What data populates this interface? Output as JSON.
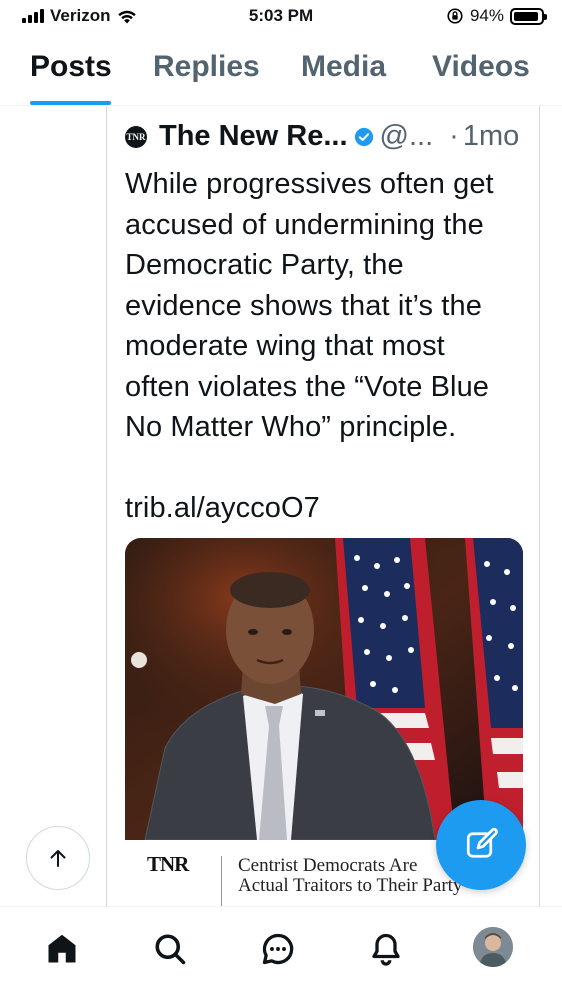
{
  "status_bar": {
    "carrier": "Verizon",
    "time": "5:03 PM",
    "battery_percent": "94%",
    "battery_level": 0.94,
    "icons": [
      "signal-icon",
      "wifi-icon",
      "orientation-lock-icon",
      "battery-icon"
    ]
  },
  "tabs": [
    {
      "label": "Posts",
      "active": true
    },
    {
      "label": "Replies",
      "active": false
    },
    {
      "label": "Media",
      "active": false
    },
    {
      "label": "Videos",
      "active": false
    }
  ],
  "post": {
    "author_avatar_text": "TNR",
    "author_name": "The New Re...",
    "handle": "@...",
    "separator": "·",
    "time": "1mo",
    "text": "While progressives often get\naccused of undermining the\nDemocratic Party, the\nevidence shows that it’s the\nmoderate wing that most\noften violates the “Vote Blue\nNo Matter Who” principle.\n\ntrib.al/ayccoO7",
    "media": {
      "logo_text": "TNR",
      "headline": "Centrist Democrats Are\nActual Traitors to Their Party"
    }
  },
  "bottom_nav": [
    {
      "icon": "home-icon",
      "active": true
    },
    {
      "icon": "search-icon",
      "active": false
    },
    {
      "icon": "spaces-icon",
      "active": false
    },
    {
      "icon": "notifications-icon",
      "active": false
    },
    {
      "icon": "profile-avatar",
      "active": false
    }
  ],
  "colors": {
    "accent": "#1d9bf0",
    "text_primary": "#0f1419",
    "text_secondary": "#536471",
    "border": "#cfd9de"
  }
}
